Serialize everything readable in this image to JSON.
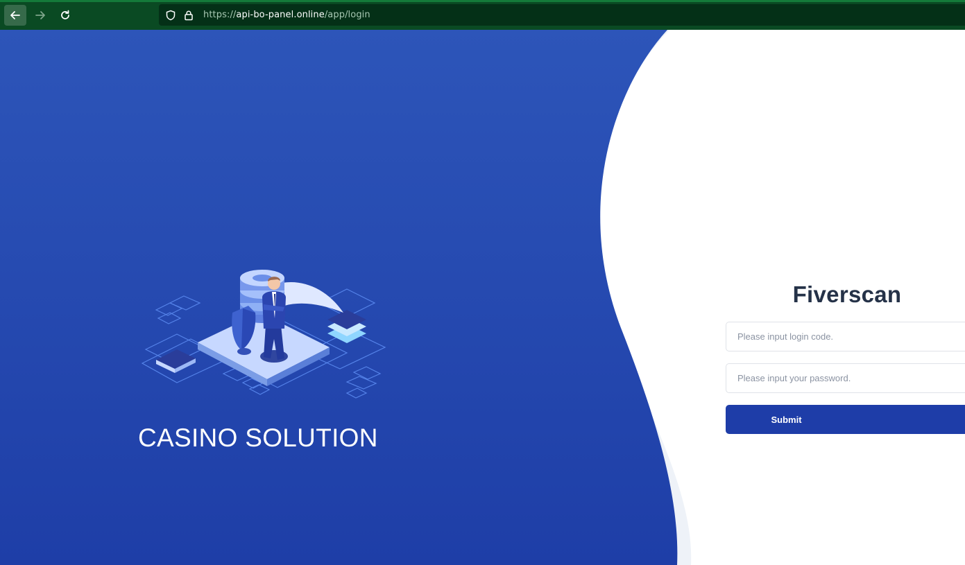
{
  "browser": {
    "url_scheme": "https://",
    "url_host": "api-bo-panel.online",
    "url_path": "/app/login",
    "back_icon": "arrow-left-icon",
    "forward_icon": "arrow-right-icon",
    "reload_icon": "reload-icon",
    "shield_icon": "shield-icon",
    "lock_icon": "lock-icon"
  },
  "hero": {
    "title": "CASINO SOLUTION",
    "illustration": "isometric-security-server-illustration",
    "color_top": "#2d54b8",
    "color_bottom": "#1f3fa8"
  },
  "login": {
    "brand": "Fiverscan",
    "code_placeholder": "Please input login code.",
    "password_placeholder": "Please input your password.",
    "submit_label": "Submit",
    "accent": "#1e3da8"
  }
}
